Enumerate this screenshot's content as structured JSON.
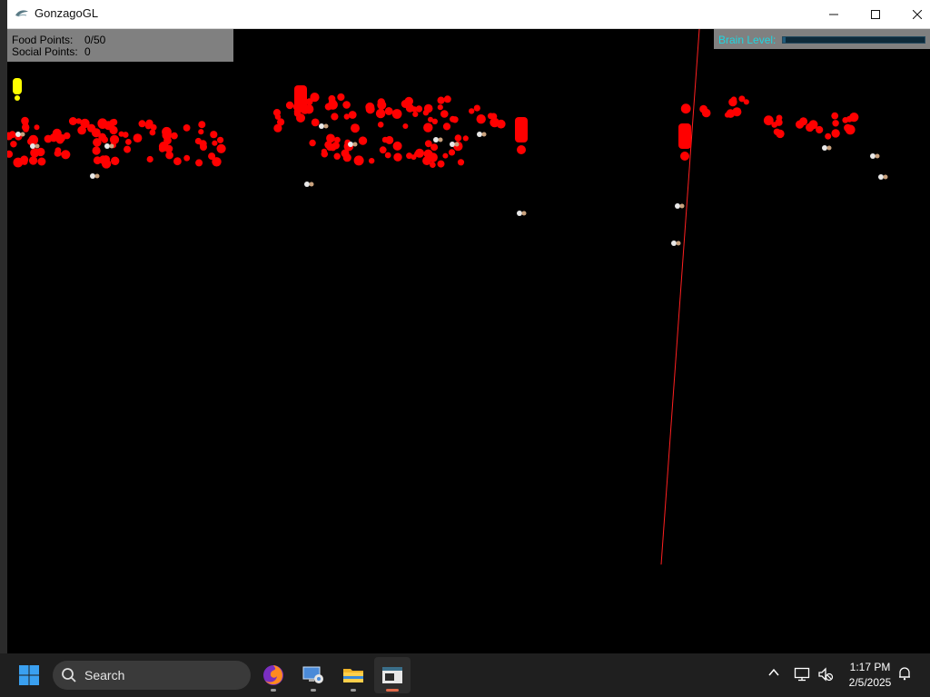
{
  "window": {
    "title": "GonzagoGL",
    "controls": {
      "minimize": "minimize",
      "maximize": "maximize",
      "close": "close"
    }
  },
  "hud": {
    "food_label": "Food Points:",
    "food_value": "0/50",
    "social_label": "Social Points:",
    "social_value": "0",
    "brain_label": "Brain Level:",
    "brain_level_fraction": 0.02
  },
  "scene": {
    "background_color": "#000000",
    "food_color": "#ff0000",
    "player_color": "#ffff00",
    "laser_color": "#ff2020",
    "creature_color": "#e8e8e8"
  },
  "taskbar": {
    "search_placeholder": "Search",
    "clock_time": "1:17 PM",
    "clock_date": "2/5/2025",
    "apps": [
      "windows-start",
      "firefox",
      "remote-desktop",
      "file-explorer",
      "gonzagogl"
    ]
  },
  "colors": {
    "taskbar_bg": "#1f1f1f",
    "hud_bg": "#808080",
    "brain_label": "#1fd6e0",
    "accent_indicator": "#e06a4a"
  }
}
